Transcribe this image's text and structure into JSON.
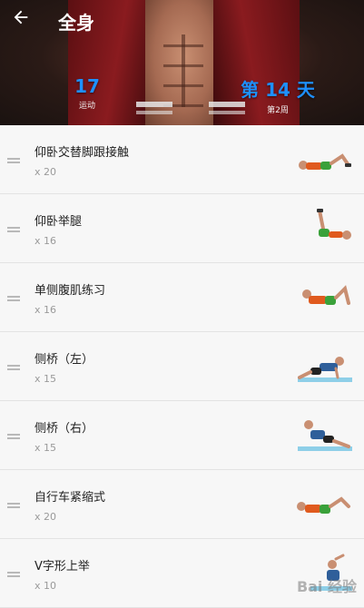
{
  "header": {
    "title": "全身",
    "stats": {
      "exercises": {
        "value": "17",
        "label": "运动"
      },
      "day": {
        "value": "第 14 天",
        "label": "第2周"
      }
    }
  },
  "exercises": [
    {
      "name": "仰卧交替脚跟接触",
      "reps": "x 20"
    },
    {
      "name": "仰卧举腿",
      "reps": "x 16"
    },
    {
      "name": "单侧腹肌练习",
      "reps": "x 16"
    },
    {
      "name": "侧桥（左）",
      "reps": "x 15"
    },
    {
      "name": "侧桥（右）",
      "reps": "x 15"
    },
    {
      "name": "自行车紧缩式",
      "reps": "x 20"
    },
    {
      "name": "V字形上举",
      "reps": "x 10"
    }
  ],
  "watermark": "Bai 经验",
  "colors": {
    "accent": "#1e90ff",
    "hoodie": "#8a1b1f",
    "shorts_green": "#3aa13a",
    "shirt_orange": "#e05a1e",
    "mat_blue": "#8ecfe8"
  }
}
